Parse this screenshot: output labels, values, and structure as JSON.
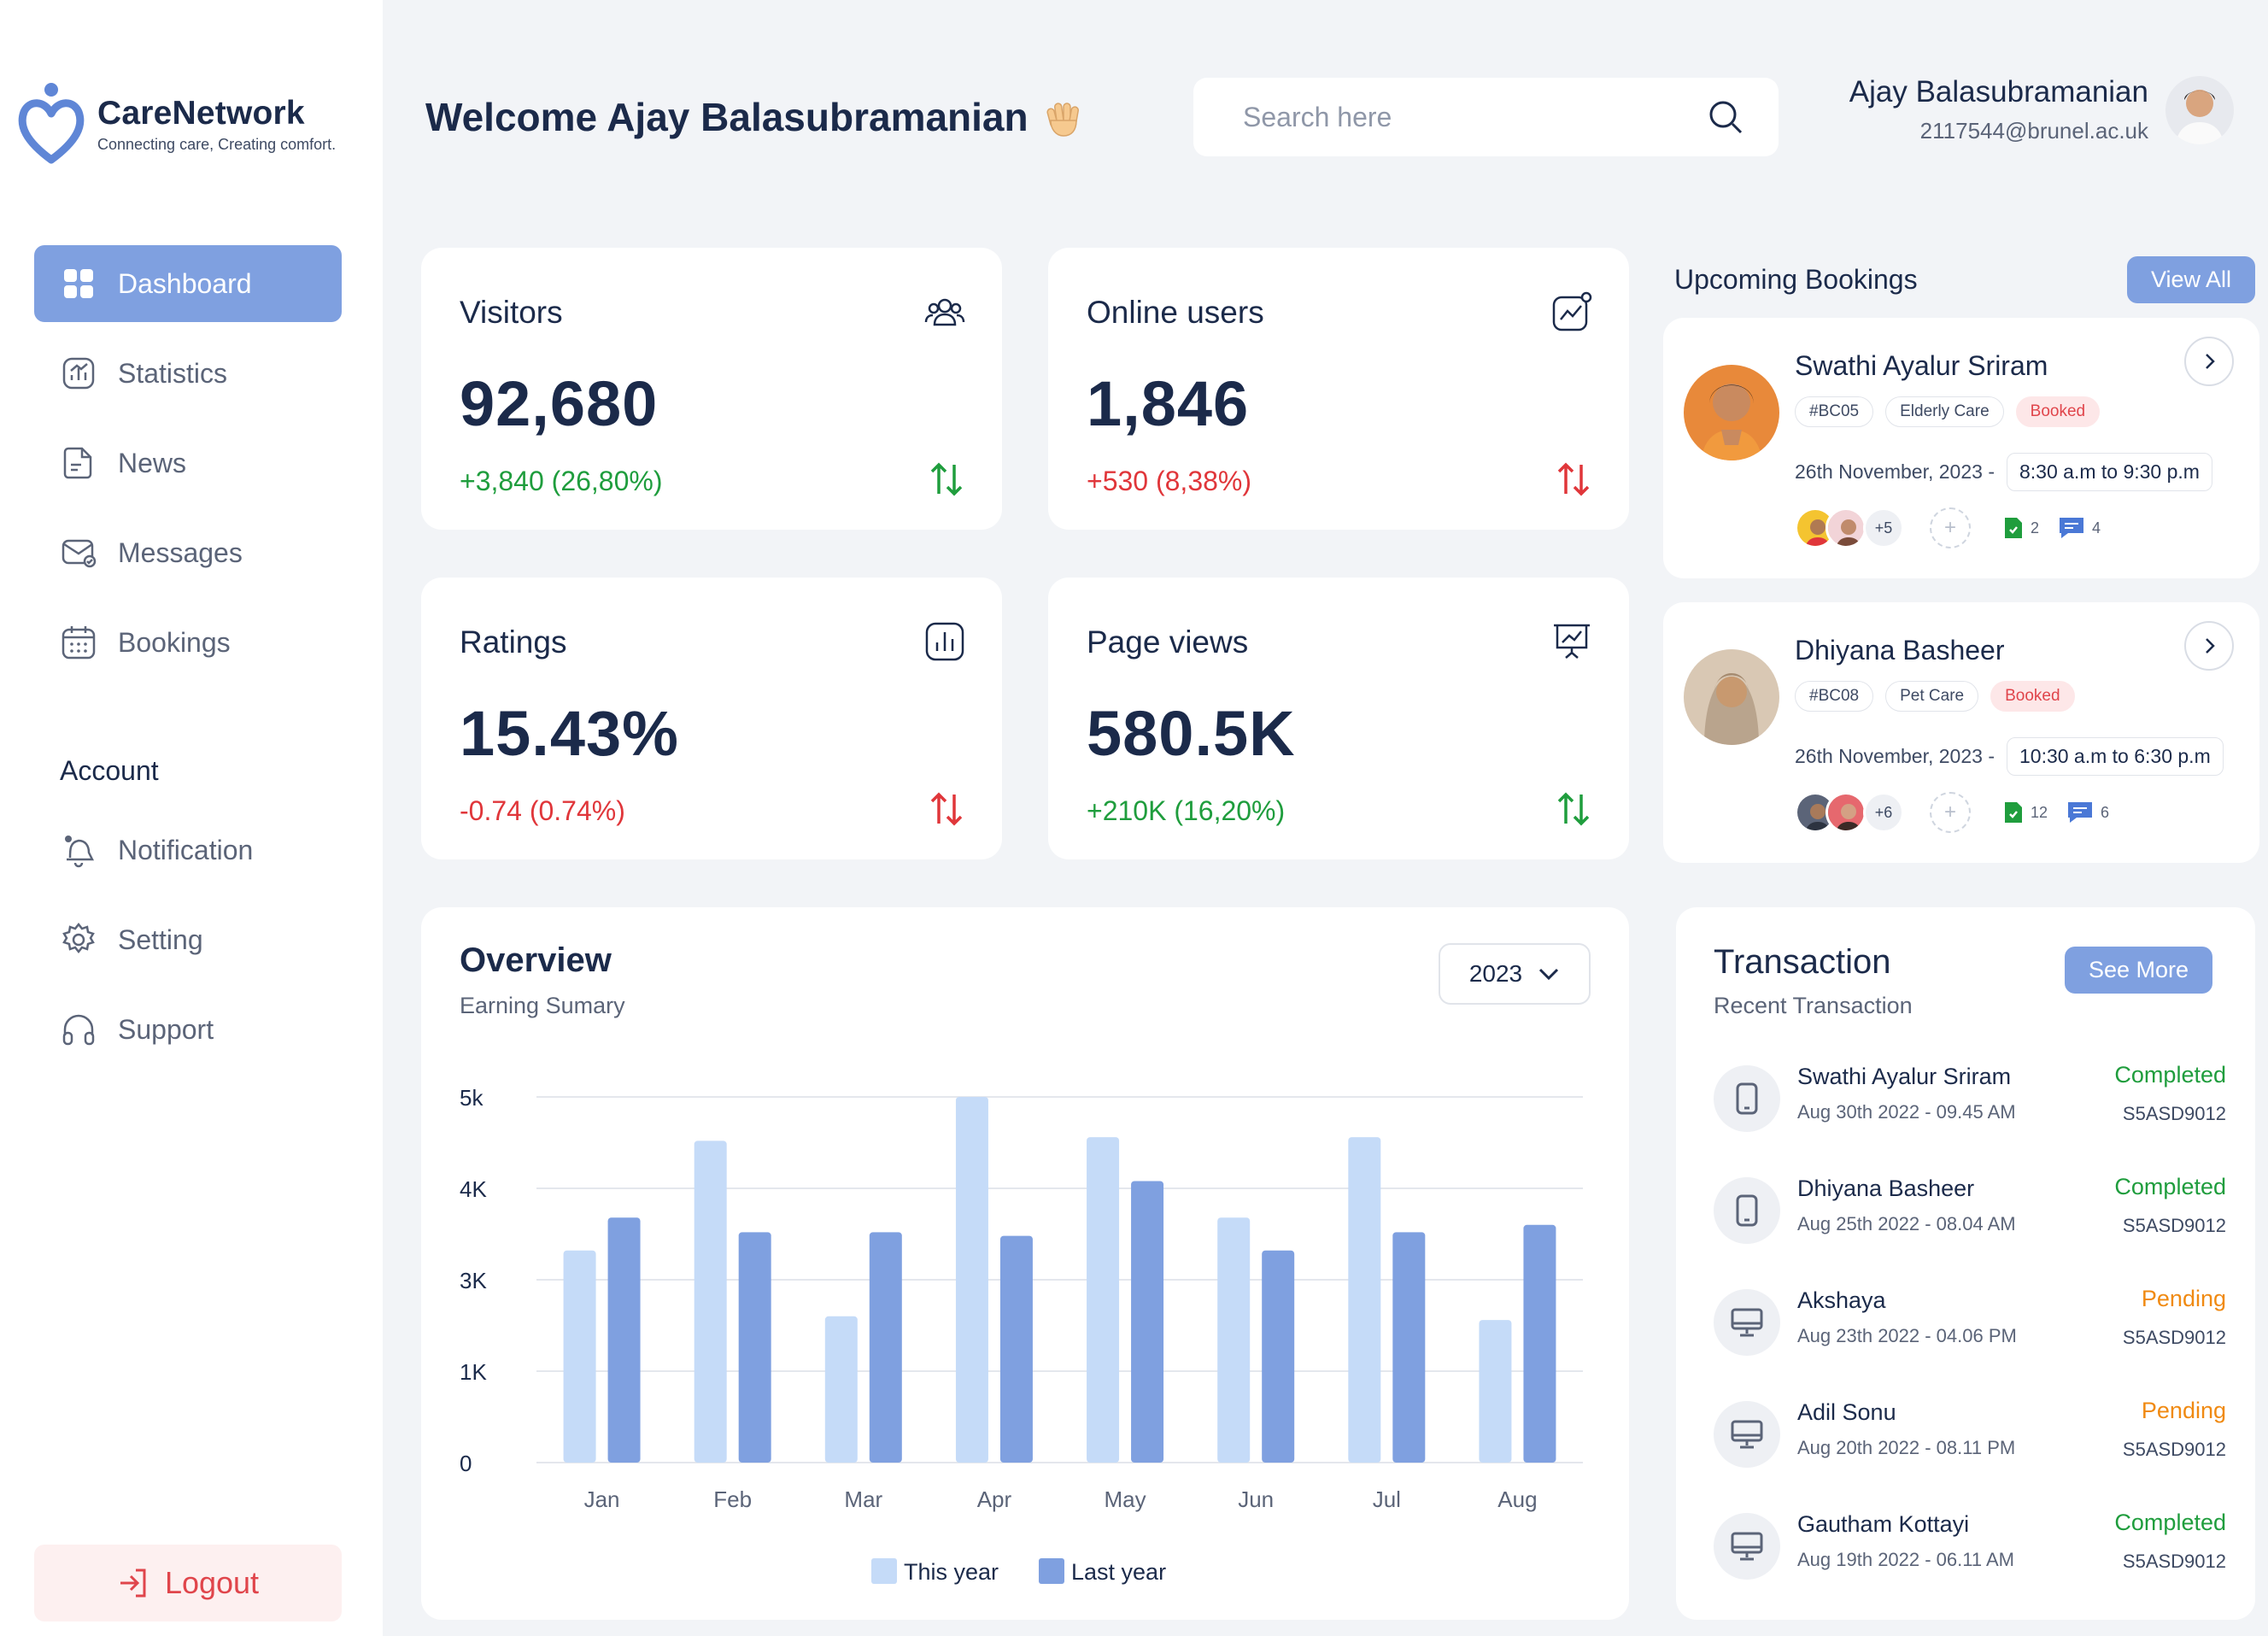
{
  "brand": {
    "name": "CareNetwork",
    "tagline": "Connecting care, Creating comfort."
  },
  "nav": {
    "items": [
      {
        "label": "Dashboard",
        "icon": "grid-icon",
        "active": true
      },
      {
        "label": "Statistics",
        "icon": "chart-icon"
      },
      {
        "label": "News",
        "icon": "news-icon"
      },
      {
        "label": "Messages",
        "icon": "messages-icon"
      },
      {
        "label": "Bookings",
        "icon": "calendar-icon"
      }
    ],
    "account_label": "Account",
    "account_items": [
      {
        "label": "Notification",
        "icon": "bell-icon"
      },
      {
        "label": "Setting",
        "icon": "gear-icon"
      },
      {
        "label": "Support",
        "icon": "headphones-icon"
      }
    ],
    "logout": "Logout"
  },
  "header": {
    "welcome": "Welcome  Ajay Balasubramanian",
    "search_placeholder": "Search here",
    "user_name": "Ajay Balasubramanian",
    "user_email": "2117544@brunel.ac.uk"
  },
  "stats": [
    {
      "title": "Visitors",
      "value": "92,680",
      "delta": "+3,840 (26,80%)",
      "trend": "up",
      "icon": "users-icon"
    },
    {
      "title": "Online users",
      "value": "1,846",
      "delta": "+530 (8,38%)",
      "trend": "down",
      "icon": "trend-icon"
    },
    {
      "title": "Ratings",
      "value": "15.43%",
      "delta": "-0.74 (0.74%)",
      "trend": "down",
      "icon": "bar-chart-icon"
    },
    {
      "title": "Page views",
      "value": "580.5K",
      "delta": "+210K (16,20%)",
      "trend": "up",
      "icon": "presentation-icon"
    }
  ],
  "bookings": {
    "title": "Upcoming Bookings",
    "view_all": "View All",
    "items": [
      {
        "name": "Swathi Ayalur Sriram",
        "code": "#BC05",
        "category": "Elderly Care",
        "status": "Booked",
        "date": "26th November, 2023 -",
        "time": "8:30 a.m to 9:30 p.m",
        "more": "+5",
        "files": "2",
        "comments": "4"
      },
      {
        "name": "Dhiyana Basheer",
        "code": "#BC08",
        "category": "Pet Care",
        "status": "Booked",
        "date": "26th November, 2023 -",
        "time": "10:30 a.m to 6:30 p.m",
        "more": "+6",
        "files": "12",
        "comments": "6"
      }
    ]
  },
  "overview": {
    "title": "Overview",
    "subtitle": "Earning Sumary",
    "year": "2023"
  },
  "chart_data": {
    "type": "bar",
    "title": "Overview",
    "subtitle": "Earning Sumary",
    "categories": [
      "Jan",
      "Feb",
      "Mar",
      "Apr",
      "May",
      "Jun",
      "Jul",
      "Aug"
    ],
    "series": [
      {
        "name": "This year",
        "color": "#c5dbf8",
        "values": [
          2900,
          4400,
          2000,
          5000,
          4450,
          3350,
          4450,
          1950
        ]
      },
      {
        "name": "Last year",
        "color": "#7fa0e0",
        "values": [
          3350,
          3150,
          3150,
          3100,
          3850,
          2900,
          3150,
          3250
        ]
      }
    ],
    "ytick_labels": [
      "0",
      "1K",
      "3K",
      "4K",
      "5k"
    ],
    "ylim": [
      0,
      5000
    ],
    "grid": true,
    "legend": "bottom"
  },
  "transactions": {
    "title": "Transaction",
    "subtitle": "Recent Transaction",
    "see_more": "See More",
    "items": [
      {
        "name": "Swathi Ayalur Sriram",
        "date": "Aug 30th 2022 - 09.45 AM",
        "status": "Completed",
        "code": "S5ASD9012",
        "icon": "phone-icon"
      },
      {
        "name": "Dhiyana Basheer",
        "date": "Aug 25th 2022 - 08.04 AM",
        "status": "Completed",
        "code": "S5ASD9012",
        "icon": "phone-icon"
      },
      {
        "name": "Akshaya",
        "date": "Aug 23th 2022 - 04.06 PM",
        "status": "Pending",
        "code": "S5ASD9012",
        "icon": "monitor-icon"
      },
      {
        "name": "Adil Sonu",
        "date": "Aug 20th 2022 - 08.11 PM",
        "status": "Pending",
        "code": "S5ASD9012",
        "icon": "monitor-icon"
      },
      {
        "name": "Gautham Kottayi",
        "date": "Aug 19th 2022 - 06.11 AM",
        "status": "Completed",
        "code": "S5ASD9012",
        "icon": "monitor-icon"
      }
    ]
  }
}
